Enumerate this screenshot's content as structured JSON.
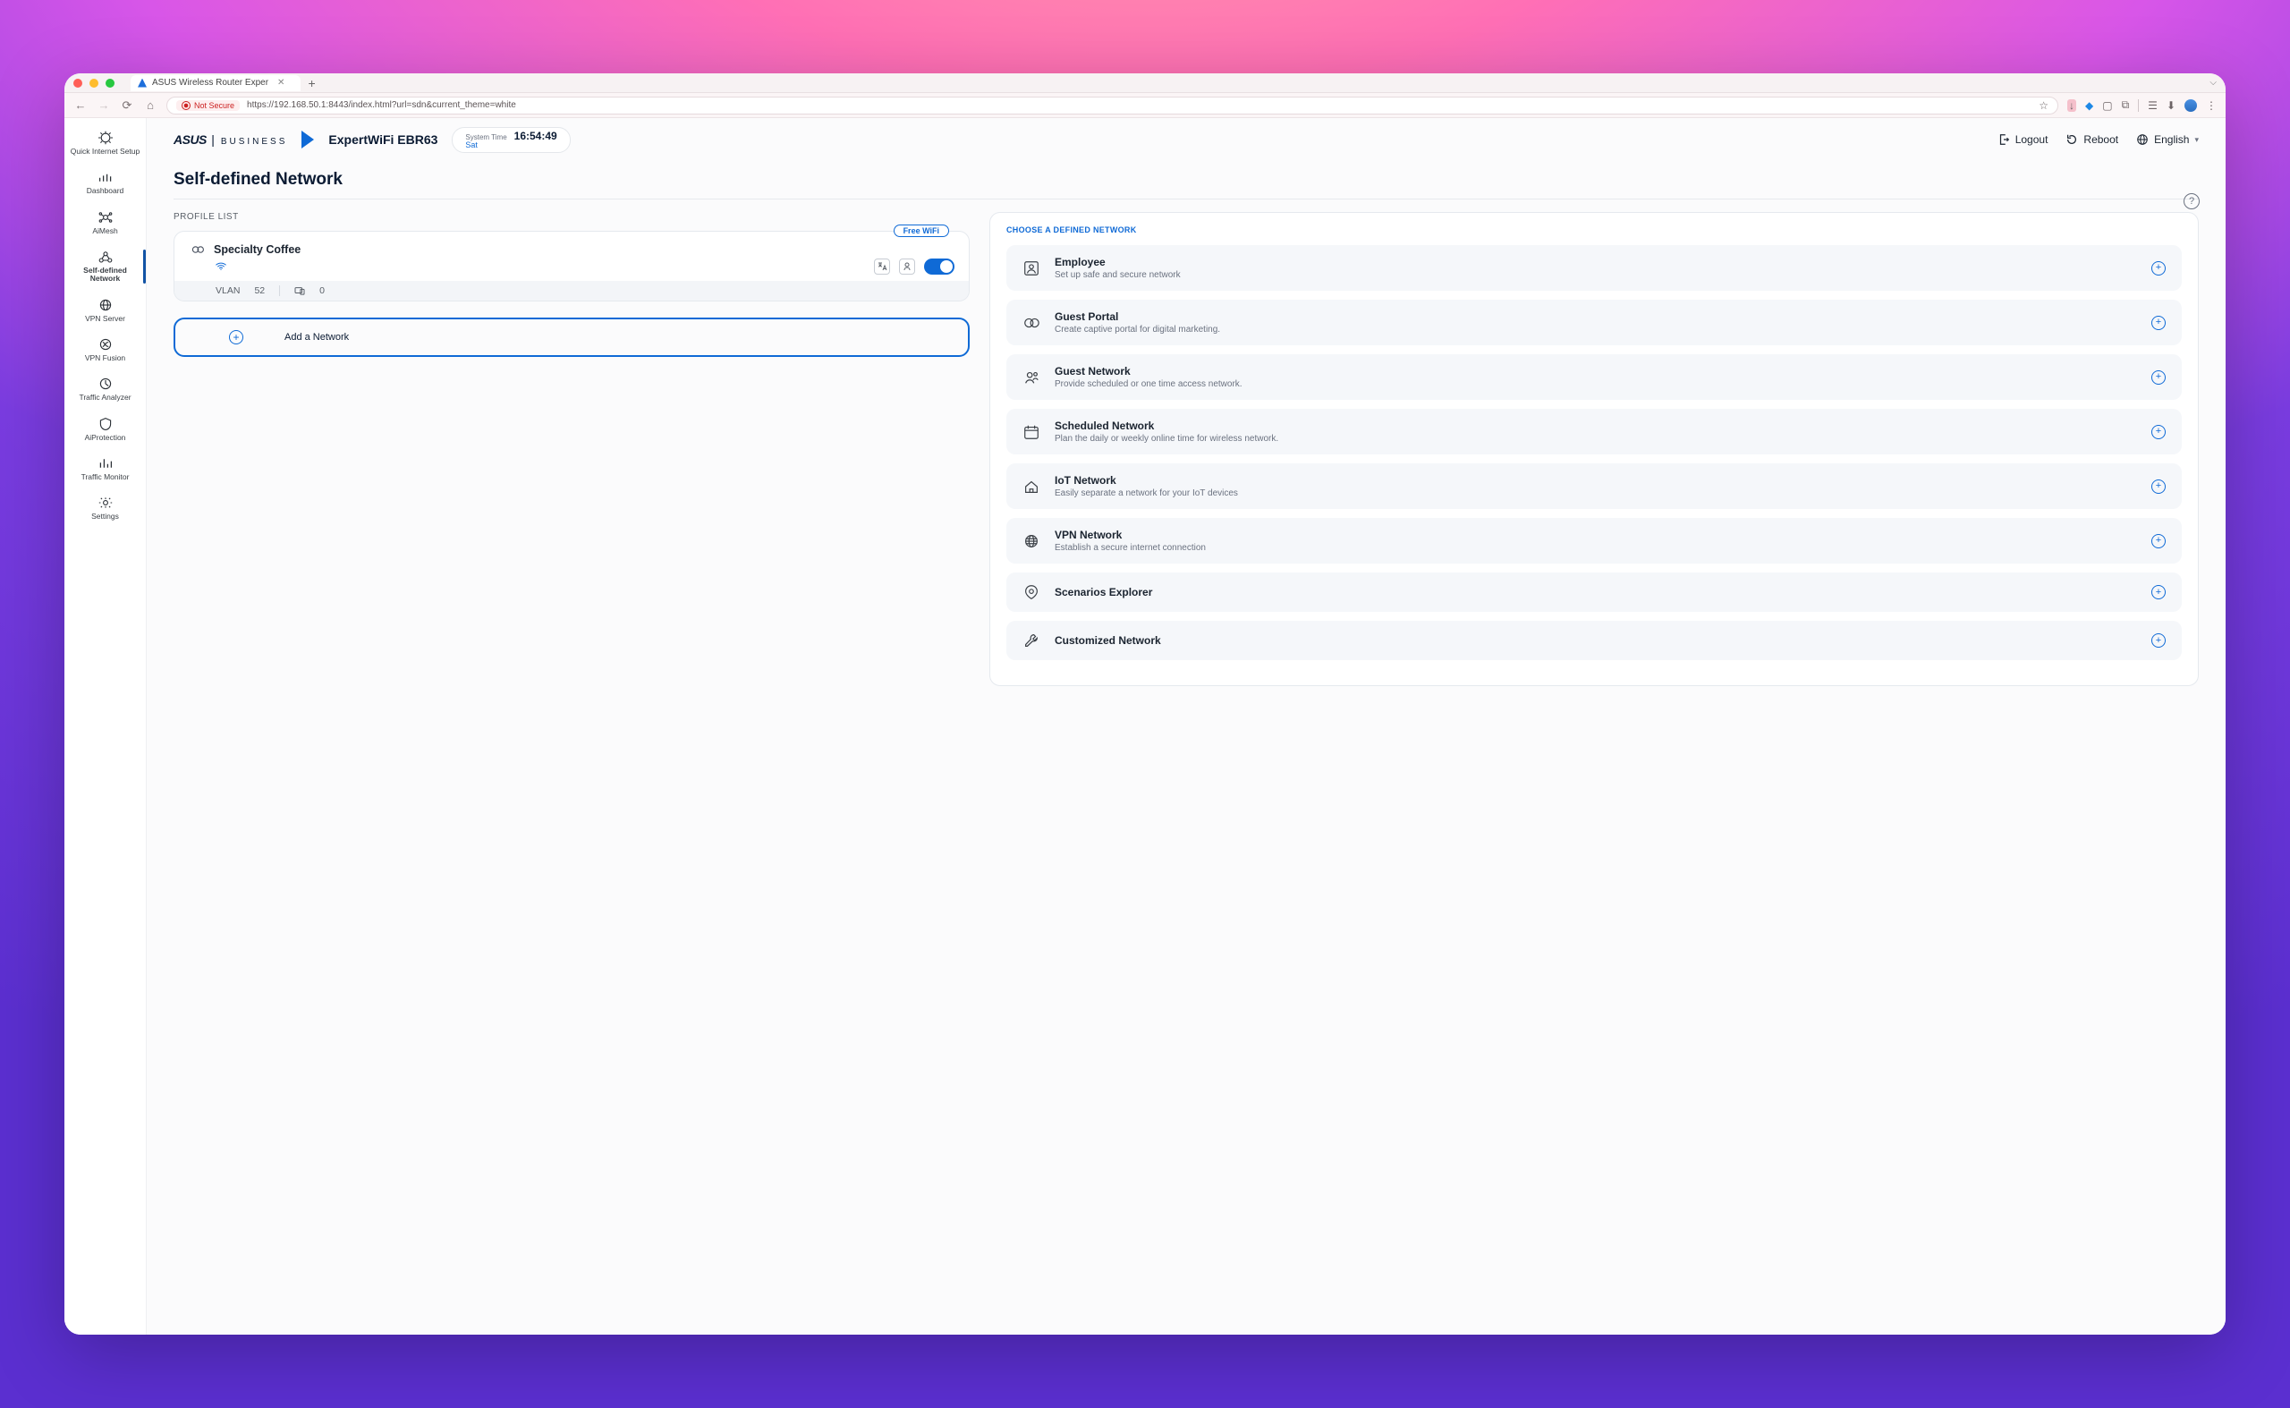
{
  "browser": {
    "tab_title": "ASUS Wireless Router Exper",
    "not_secure_label": "Not Secure",
    "url": "https://192.168.50.1:8443/index.html?url=sdn&current_theme=white"
  },
  "header": {
    "brand": "ASUS",
    "brand_sub": "BUSINESS",
    "model": "ExpertWiFi EBR63",
    "systime_label": "System Time",
    "day": "Sat",
    "clock": "16:54:49",
    "logout": "Logout",
    "reboot": "Reboot",
    "language": "English"
  },
  "sidebar": {
    "items": [
      {
        "label": "Quick Internet Setup"
      },
      {
        "label": "Dashboard"
      },
      {
        "label": "AiMesh"
      },
      {
        "label": "Self-defined Network"
      },
      {
        "label": "VPN Server"
      },
      {
        "label": "VPN Fusion"
      },
      {
        "label": "Traffic Analyzer"
      },
      {
        "label": "AiProtection"
      },
      {
        "label": "Traffic Monitor"
      },
      {
        "label": "Settings"
      }
    ],
    "active_index": 3
  },
  "page": {
    "title": "Self-defined Network",
    "profile_list_label": "PROFILE LIST",
    "profile": {
      "name": "Specialty Coffee",
      "badge": "Free WiFi",
      "vlan_label": "VLAN",
      "vlan_value": "52",
      "devices_count": "0",
      "toggle_on": true
    },
    "add_network_label": "Add a Network",
    "choose_label": "CHOOSE A DEFINED NETWORK",
    "network_types": [
      {
        "title": "Employee",
        "desc": "Set up safe and secure network"
      },
      {
        "title": "Guest Portal",
        "desc": "Create captive portal for digital marketing."
      },
      {
        "title": "Guest Network",
        "desc": "Provide scheduled or one time access network."
      },
      {
        "title": "Scheduled Network",
        "desc": "Plan the daily or weekly online time for wireless network."
      },
      {
        "title": "IoT Network",
        "desc": "Easily separate a network for your IoT devices"
      },
      {
        "title": "VPN Network",
        "desc": "Establish a secure internet connection"
      },
      {
        "title": "Scenarios Explorer",
        "desc": ""
      },
      {
        "title": "Customized Network",
        "desc": ""
      }
    ]
  }
}
